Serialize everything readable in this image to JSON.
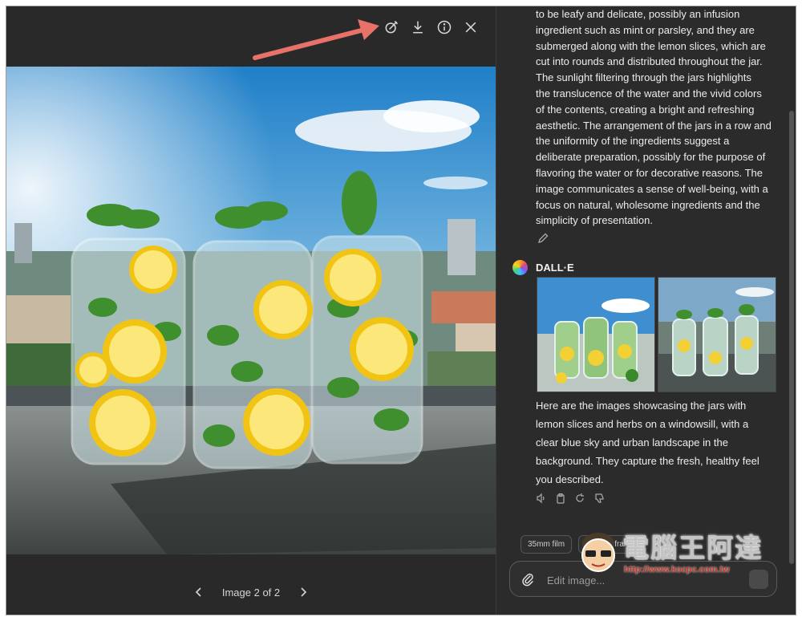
{
  "viewer": {
    "toolbar": {
      "icons": [
        "select-edit-icon",
        "download-icon",
        "info-icon",
        "close-icon"
      ]
    },
    "pager": {
      "label": "Image 2 of 2"
    }
  },
  "chat": {
    "description_lines": [
      "to be leafy and delicate, possibly an infusion",
      "ingredient such as mint or parsley, and they are",
      "submerged along with the lemon slices, which are",
      "cut into rounds and distributed throughout the jar.",
      "The sunlight filtering through the jars highlights",
      "the translucence of the water and the vivid colors",
      "of the contents, creating a bright and refreshing",
      "aesthetic. The arrangement of the jars in a row and",
      "the uniformity of the ingredients suggest a",
      "deliberate preparation, possibly for the purpose of",
      "flavoring the water or for decorative reasons. The",
      "image communicates a sense of well-being, with a",
      "focus on natural, wholesome ingredients and the",
      "simplicity of presentation."
    ],
    "author": "DALL·E",
    "reply_lines": [
      "Here are the images showcasing the jars with",
      "lemon slices and herbs on a windowsill, with a",
      "clear blue sky and urban landscape in the",
      "background. They capture the fresh, healthy feel",
      "you described."
    ],
    "chips": [
      "35mm film",
      "3D Wireframe"
    ],
    "composer": {
      "placeholder": "Edit image..."
    }
  },
  "watermark": {
    "title": "電腦王阿達",
    "url": "http://www.kocpc.com.tw"
  },
  "colors": {
    "panel_bg": "#2b2b2b",
    "arrow": "#e8726a",
    "text": "#ececec"
  }
}
